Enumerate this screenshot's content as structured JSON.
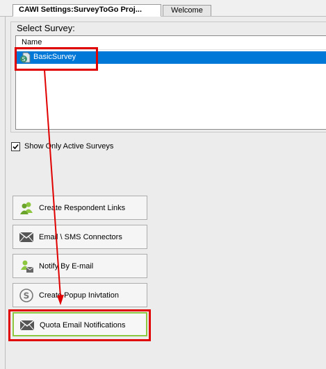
{
  "tabs": [
    {
      "label": "CAWI  Settings:SurveyToGo Proj...",
      "active": true
    },
    {
      "label": "Welcome",
      "active": false
    }
  ],
  "select_survey": {
    "label": "Select Survey:",
    "column_header": "Name",
    "surveys": [
      {
        "name": "BasicSurvey",
        "selected": true
      }
    ]
  },
  "active_filter": {
    "label": "Show Only Active Surveys",
    "checked": true
  },
  "actions": [
    {
      "label": "Create Respondent Links",
      "icon": "users-icon"
    },
    {
      "label": "Email \\ SMS Connectors",
      "icon": "envelope-icon"
    },
    {
      "label": "Notify By E-mail",
      "icon": "notify-users-icon"
    },
    {
      "label": "Create Popup Inivtation",
      "icon": "dollar-circle-icon"
    },
    {
      "label": "Quota Email Notifications",
      "icon": "envelope-icon",
      "highlighted": true
    }
  ],
  "colors": {
    "selection": "#0078d7",
    "annotation": "#e00000",
    "highlight_border": "#8dc63f"
  }
}
